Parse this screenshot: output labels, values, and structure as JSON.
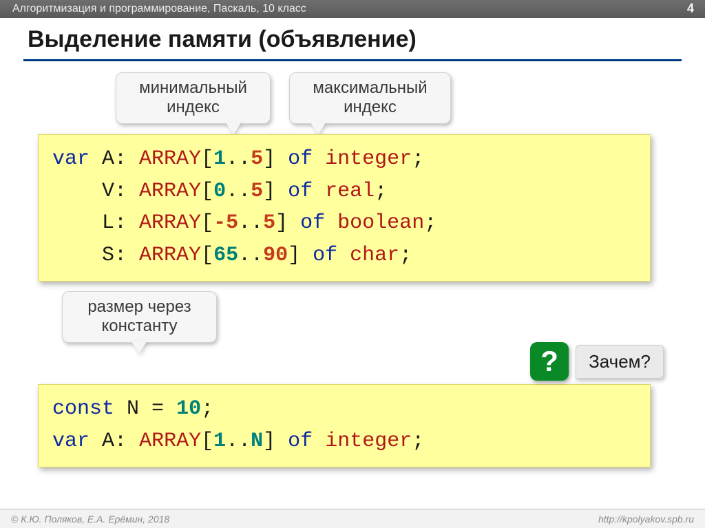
{
  "header": {
    "breadcrumb": "Алгоритмизация и программирование, Паскаль, 10 класс",
    "pageNumber": "4"
  },
  "title": "Выделение памяти (объявление)",
  "callouts": {
    "min": {
      "line1": "минимальный",
      "line2": "индекс"
    },
    "max": {
      "line1": "максимальный",
      "line2": "индекс"
    },
    "const": {
      "line1": "размер через",
      "line2": "константу"
    }
  },
  "code1": {
    "prefix": "var ",
    "l1": {
      "name": "A",
      "kw": "ARRAY",
      "lo": "1",
      "hi": "5",
      "of": "of",
      "ty": "integer"
    },
    "l2": {
      "name": "V",
      "kw": "ARRAY",
      "lo": "0",
      "hi": "5",
      "of": "of",
      "ty": "real"
    },
    "l3": {
      "name": "L",
      "kw": "ARRAY",
      "lo": "-5",
      "hi": "5",
      "of": "of",
      "ty": "boolean"
    },
    "l4": {
      "name": "S",
      "kw": "ARRAY",
      "lo": "65",
      "hi": "90",
      "of": "of",
      "ty": "char"
    }
  },
  "code2": {
    "constKw": "const",
    "constName": "N",
    "constVal": "10",
    "varKw": "var",
    "name": "A",
    "arr": "ARRAY",
    "lo": "1",
    "hiRef": "N",
    "of": "of",
    "ty": "integer"
  },
  "qb": {
    "mark": "?",
    "text": "Зачем?"
  },
  "footer": {
    "left": "© К.Ю. Поляков, Е.А. Ерёмин, 2018",
    "right": "http://kpolyakov.spb.ru"
  }
}
